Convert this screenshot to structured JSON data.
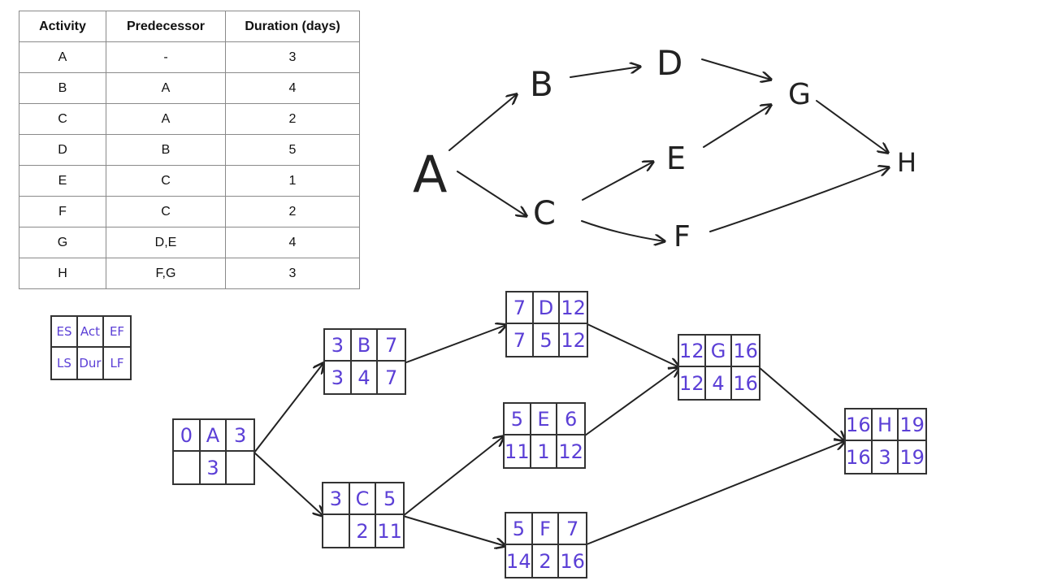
{
  "table": {
    "headers": [
      "Activity",
      "Predecessor",
      "Duration (days)"
    ],
    "rows": [
      {
        "activity": "A",
        "predecessor": "-",
        "duration": "3"
      },
      {
        "activity": "B",
        "predecessor": "A",
        "duration": "4"
      },
      {
        "activity": "C",
        "predecessor": "A",
        "duration": "2"
      },
      {
        "activity": "D",
        "predecessor": "B",
        "duration": "5"
      },
      {
        "activity": "E",
        "predecessor": "C",
        "duration": "1"
      },
      {
        "activity": "F",
        "predecessor": "C",
        "duration": "2"
      },
      {
        "activity": "G",
        "predecessor": "D,E",
        "duration": "4"
      },
      {
        "activity": "H",
        "predecessor": "F,G",
        "duration": "3"
      }
    ]
  },
  "network_sketch": {
    "nodes": [
      "A",
      "B",
      "C",
      "D",
      "E",
      "F",
      "G",
      "H"
    ],
    "edges": [
      [
        "A",
        "B"
      ],
      [
        "A",
        "C"
      ],
      [
        "B",
        "D"
      ],
      [
        "C",
        "E"
      ],
      [
        "C",
        "F"
      ],
      [
        "D",
        "G"
      ],
      [
        "E",
        "G"
      ],
      [
        "G",
        "H"
      ],
      [
        "F",
        "H"
      ]
    ]
  },
  "legend": {
    "es": "ES",
    "act": "Act",
    "ef": "EF",
    "ls": "LS",
    "dur": "Dur",
    "lf": "LF"
  },
  "aon_nodes": {
    "A": {
      "es": "0",
      "act": "A",
      "ef": "3",
      "ls": "",
      "dur": "3",
      "lf": ""
    },
    "B": {
      "es": "3",
      "act": "B",
      "ef": "7",
      "ls": "3",
      "dur": "4",
      "lf": "7"
    },
    "C": {
      "es": "3",
      "act": "C",
      "ef": "5",
      "ls": "",
      "dur": "2",
      "lf": "11"
    },
    "D": {
      "es": "7",
      "act": "D",
      "ef": "12",
      "ls": "7",
      "dur": "5",
      "lf": "12"
    },
    "E": {
      "es": "5",
      "act": "E",
      "ef": "6",
      "ls": "11",
      "dur": "1",
      "lf": "12"
    },
    "F": {
      "es": "5",
      "act": "F",
      "ef": "7",
      "ls": "14",
      "dur": "2",
      "lf": "16"
    },
    "G": {
      "es": "12",
      "act": "G",
      "ef": "16",
      "ls": "12",
      "dur": "4",
      "lf": "16"
    },
    "H": {
      "es": "16",
      "act": "H",
      "ef": "19",
      "ls": "16",
      "dur": "3",
      "lf": "19"
    }
  },
  "colors": {
    "handwriting": "#5b3fd6",
    "lines": "#222222",
    "table_border": "#8a8a8a"
  }
}
